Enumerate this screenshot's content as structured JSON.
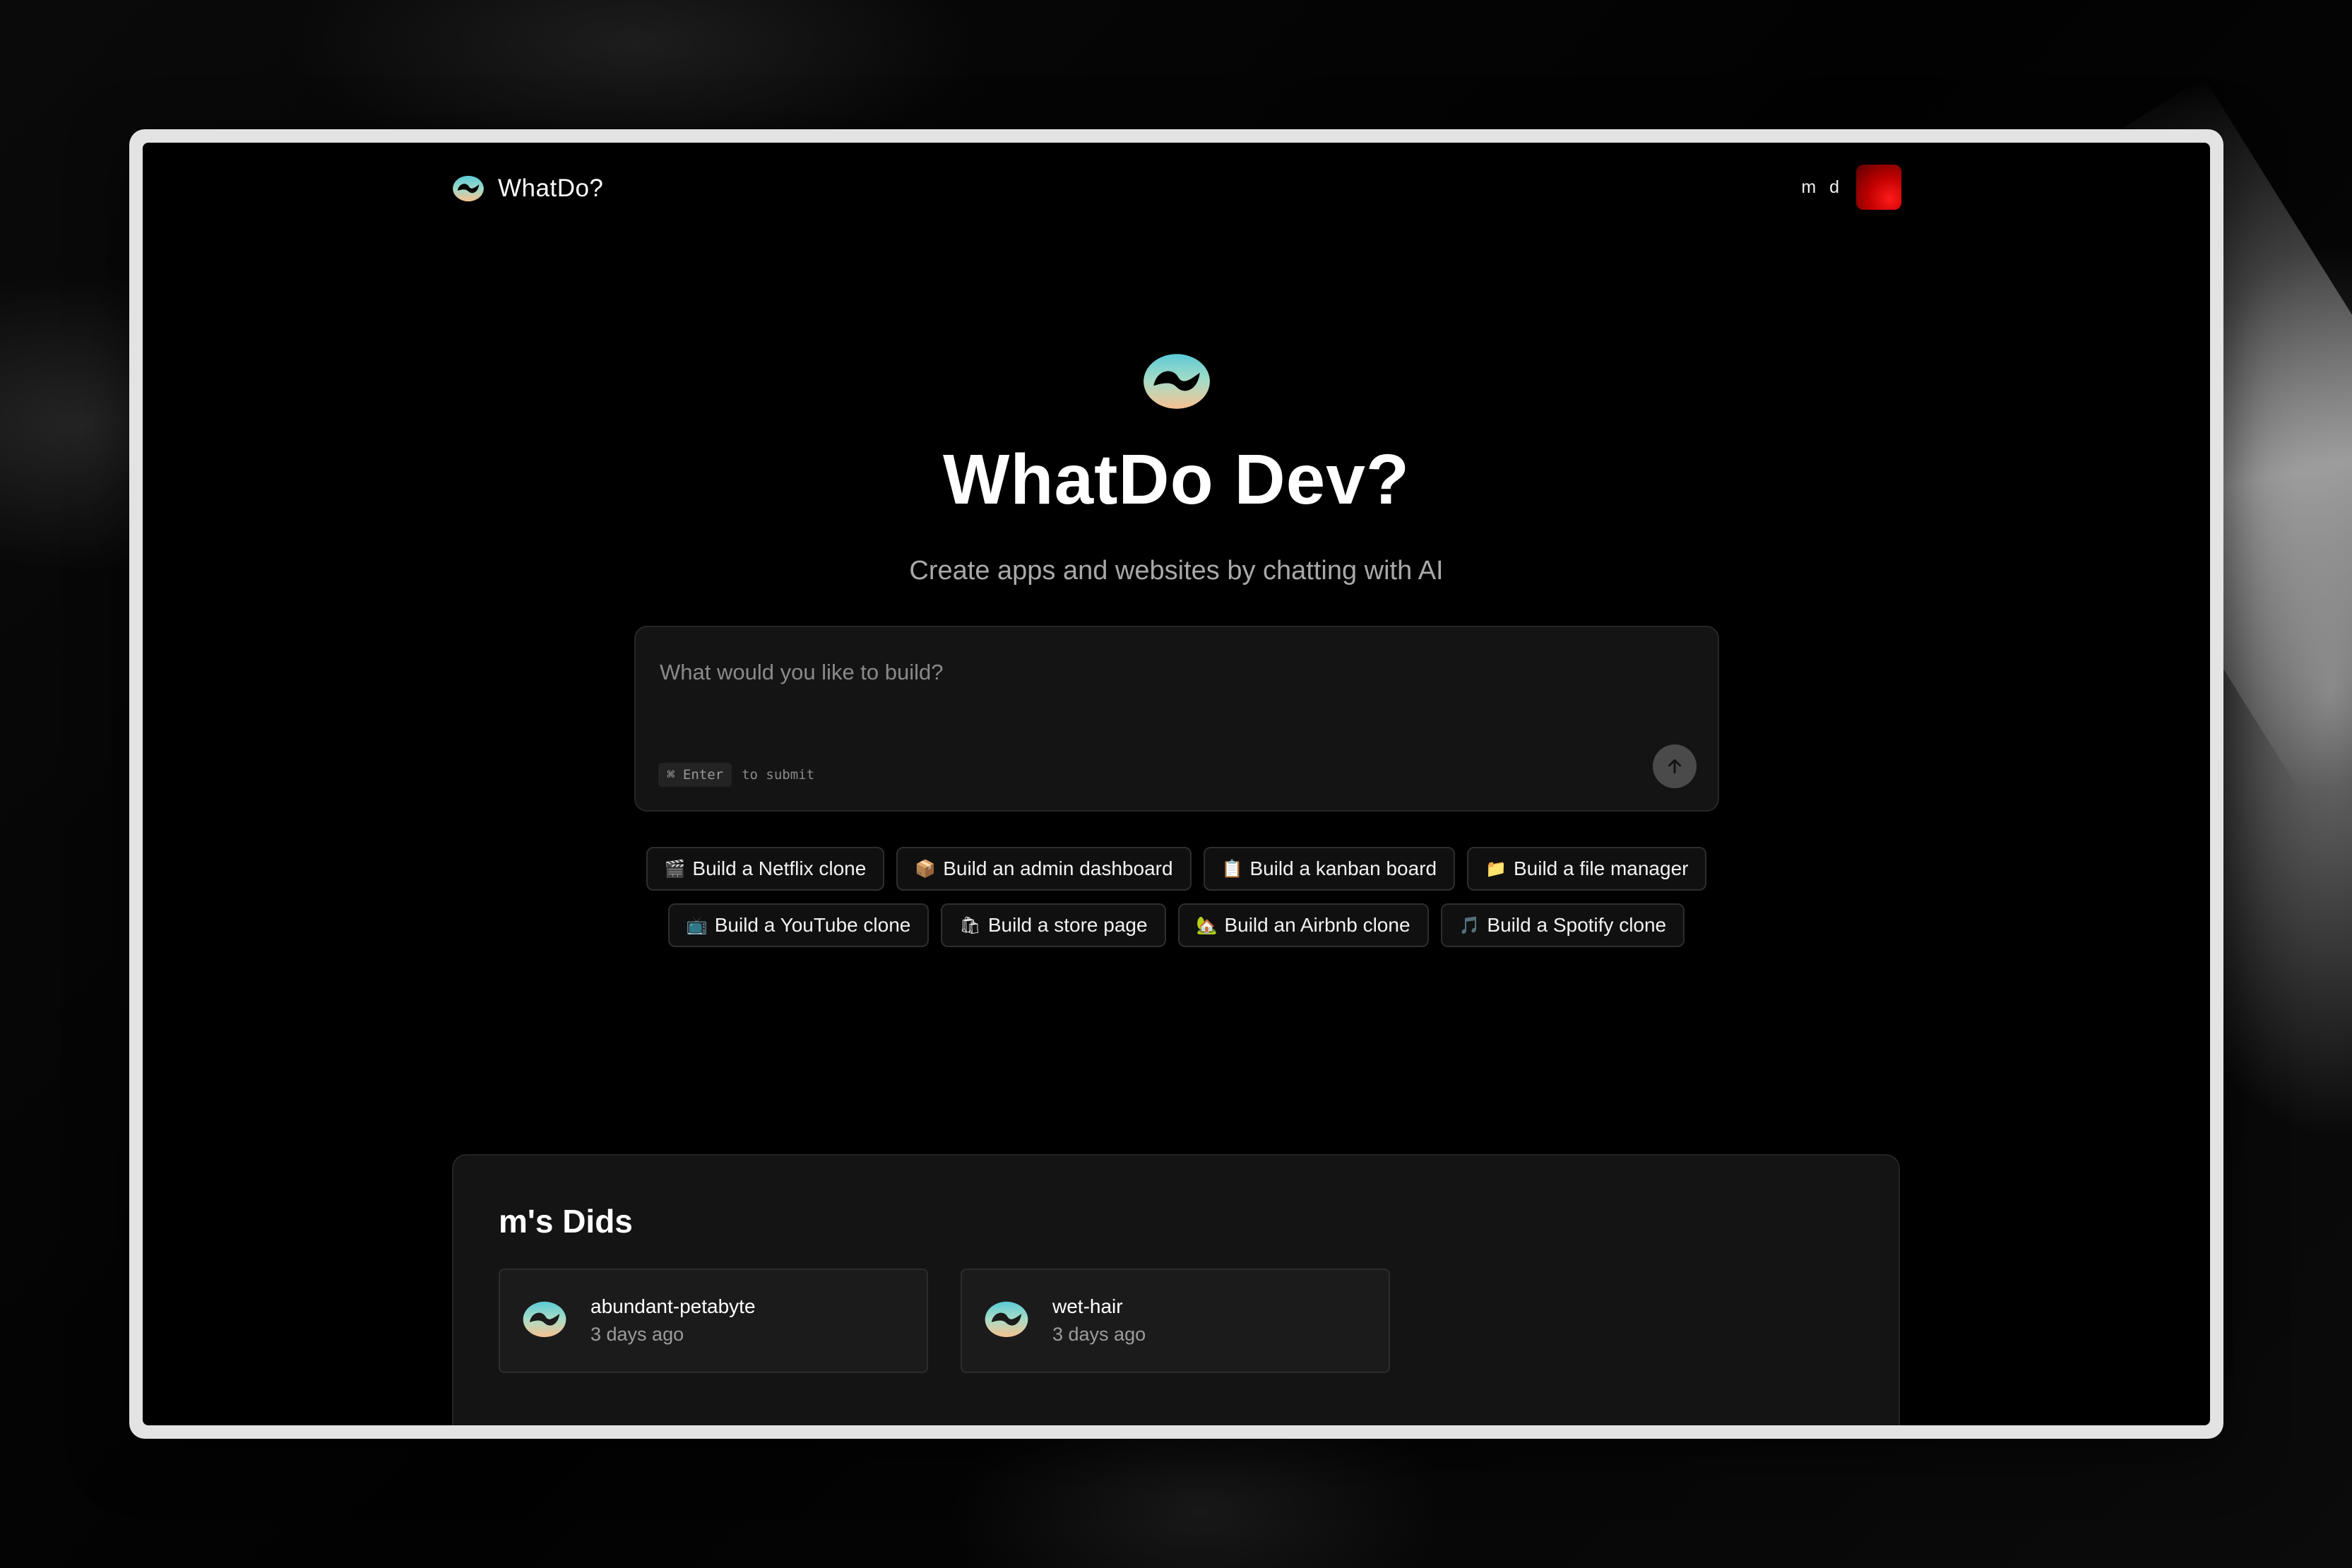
{
  "app": {
    "name": "WhatDo?",
    "user_initials": "m d"
  },
  "hero": {
    "title": "WhatDo Dev?",
    "subtitle": "Create apps and websites by chatting with AI"
  },
  "prompt": {
    "placeholder": "What would you like to build?",
    "value": "",
    "hint_key": "⌘ Enter",
    "hint_text": "to submit"
  },
  "suggestions": {
    "row1": [
      {
        "emoji": "🎬",
        "label": "Build a Netflix clone"
      },
      {
        "emoji": "📦",
        "label": "Build an admin dashboard"
      },
      {
        "emoji": "📋",
        "label": "Build a kanban board"
      },
      {
        "emoji": "📁",
        "label": "Build a file manager"
      }
    ],
    "row2": [
      {
        "emoji": "📺",
        "label": "Build a YouTube clone"
      },
      {
        "emoji": "🛍",
        "label": "Build a store page"
      },
      {
        "emoji": "🏡",
        "label": "Build an Airbnb clone"
      },
      {
        "emoji": "🎵",
        "label": "Build a Spotify clone"
      }
    ]
  },
  "dids": {
    "title": "m's Dids",
    "items": [
      {
        "name": "abundant-petabyte",
        "time": "3 days ago"
      },
      {
        "name": "wet-hair",
        "time": "3 days ago"
      }
    ]
  },
  "colors": {
    "logo_teal": "#4fc3cf",
    "logo_peach": "#f6c79a",
    "avatar_red": "#e00000",
    "background": "#000000",
    "panel": "#141414"
  }
}
